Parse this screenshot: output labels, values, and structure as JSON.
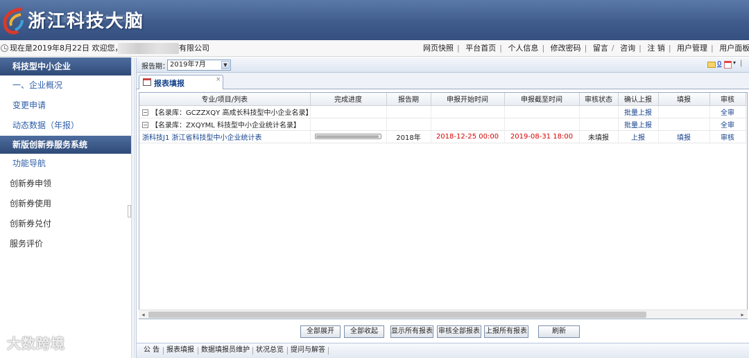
{
  "header": {
    "logo_text": "浙江科技大脑"
  },
  "infobar": {
    "welcome": "现在是2019年8月22日 欢迎您，",
    "company_suffix": "有限公司",
    "nav": [
      "网页快照",
      "平台首页",
      "个人信息",
      "修改密码",
      "留言",
      "咨询",
      "注 销",
      "用户管理",
      "用户面板"
    ]
  },
  "sidebar": {
    "section1_title": "科技型中小企业",
    "section1_items": [
      "一、企业概况",
      "变更申请",
      "动态数据（年报）"
    ],
    "section2_title": "新版创新券服务系统",
    "section2_items": [
      "功能导航"
    ],
    "plain_items": [
      "创新券申领",
      "创新券使用",
      "创新券兑付",
      "服务评价"
    ]
  },
  "watermark": "大数跨境",
  "toolbar": {
    "period_label": "报告期：",
    "period_value": "2019年7月",
    "mail_count": "0"
  },
  "tab": {
    "label": "报表填报",
    "close": "×"
  },
  "grid": {
    "columns": [
      "专业/项目/列表",
      "完成进度",
      "报告期",
      "申报开始时间",
      "申报截至时间",
      "审核状态",
      "确认上报",
      "填报",
      "审核"
    ],
    "groups": [
      {
        "toggle": "−",
        "title": "【名录库：GCZZXQY 高成长科技型中小企业名录】",
        "confirm": "批量上报",
        "audit": "全审"
      },
      {
        "toggle": "−",
        "title": "【名录库：ZXQYML 科技型中小企业统计名录】",
        "confirm": "批量上报",
        "audit": "全审"
      }
    ],
    "row": {
      "name": "浙科技J1  浙江省科技型中小企业统计表",
      "progress": 0.98,
      "period": "2018年",
      "start": "2018-12-25 00:00",
      "end": "2019-08-31 18:00",
      "status": "未填报",
      "confirm": "上报",
      "fill": "填报",
      "audit": "审核"
    }
  },
  "buttons": [
    "全部展开",
    "全部收起",
    "显示所有报表",
    "审核全部报表",
    "上报所有报表",
    "刷新"
  ],
  "bottom_tabs": [
    "公 告",
    "报表填报",
    "数据填报员维护",
    "状况总览",
    "提问与解答"
  ],
  "colors": {
    "header": "#3f5c8d",
    "accent": "#15428b",
    "red": "#d60000"
  }
}
